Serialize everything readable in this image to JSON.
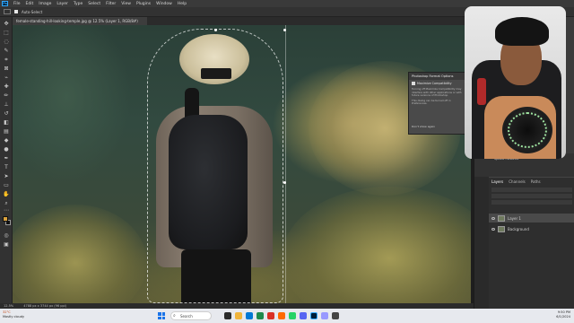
{
  "app": {
    "logo": "Ps",
    "menu": [
      "File",
      "Edit",
      "Image",
      "Layer",
      "Type",
      "Select",
      "Filter",
      "View",
      "Plugins",
      "Window",
      "Help"
    ]
  },
  "options_bar": {
    "tool": "marquee-tool",
    "auto_select_label": "Auto-Select",
    "show_label": "Show Transform Controls"
  },
  "document": {
    "tab_title": "female-standing-hill-looking-temple.jpg @ 12.5% (Layer 1, RGB/8#)"
  },
  "status": {
    "zoom": "12.5%",
    "dimensions": "4788 px x 3744 px (96 ppi)"
  },
  "dialog": {
    "title": "Photoshop Format Options",
    "maximize_label": "Maximize Compatibility",
    "body_1": "Turning off Maximize Compatibility may interfere with other applications or with future versions of Photoshop.",
    "body_2": "This dialog can be turned off in Preferences.",
    "dont_show": "Don't show again"
  },
  "panels": {
    "quick_actions": "Quick Actions",
    "layer_tabs": [
      "Layers",
      "Channels",
      "Paths"
    ],
    "layers": [
      {
        "name": "Layer 1",
        "selected": true
      },
      {
        "name": "Background",
        "selected": false
      }
    ]
  },
  "taskbar": {
    "weather_temp": "32°C",
    "weather_desc": "Mostly cloudy",
    "search_placeholder": "Search",
    "time": "9:50 PM",
    "date": "6/1/2024"
  },
  "colors": {
    "ps_blue": "#31a8ff",
    "panel_bg": "#323232",
    "foreground_swatch": "#d9a13c",
    "taskbar_bg": "#e7e9ee"
  }
}
